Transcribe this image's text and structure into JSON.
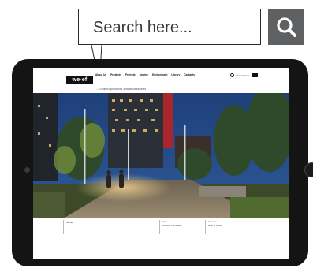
{
  "search": {
    "placeholder_text": "Search here...",
    "button_icon": "search-icon",
    "button_color": "#5e6062"
  },
  "site": {
    "logo": "we-ef",
    "nav": [
      "About Us",
      "Products",
      "Projects",
      "Service",
      "Environment",
      "Library",
      "Contacts"
    ],
    "international": "International",
    "search_strip": "→ Search products and accessories"
  },
  "info": {
    "col1_value": "Name",
    "col2_label": "Place",
    "col2_value": "FLOOR PROJECT",
    "col3_label": "Products",
    "col3_value": "AML & Series"
  }
}
